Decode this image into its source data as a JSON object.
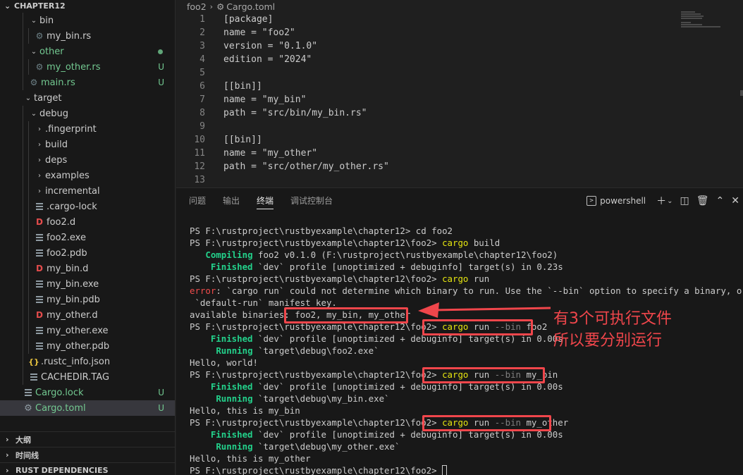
{
  "explorer": {
    "title": "CHAPTER12",
    "items": [
      {
        "label": "bin",
        "kind": "folder",
        "open": true,
        "depth": 2
      },
      {
        "label": "my_bin.rs",
        "kind": "rust",
        "depth": 3
      },
      {
        "label": "other",
        "kind": "folder",
        "open": true,
        "depth": 2,
        "git": true,
        "dot": true
      },
      {
        "label": "my_other.rs",
        "kind": "rust",
        "depth": 3,
        "git": true,
        "badge": "U"
      },
      {
        "label": "main.rs",
        "kind": "rust",
        "depth": 2,
        "git": true,
        "badge": "U"
      },
      {
        "label": "target",
        "kind": "folder",
        "open": true,
        "depth": 1
      },
      {
        "label": "debug",
        "kind": "folder",
        "open": true,
        "depth": 2
      },
      {
        "label": ".fingerprint",
        "kind": "folder",
        "open": false,
        "depth": 3
      },
      {
        "label": "build",
        "kind": "folder",
        "open": false,
        "depth": 3
      },
      {
        "label": "deps",
        "kind": "folder",
        "open": false,
        "depth": 3
      },
      {
        "label": "examples",
        "kind": "folder",
        "open": false,
        "depth": 3
      },
      {
        "label": "incremental",
        "kind": "folder",
        "open": false,
        "depth": 3
      },
      {
        "label": ".cargo-lock",
        "kind": "lines",
        "depth": 3
      },
      {
        "label": "foo2.d",
        "kind": "d",
        "depth": 3
      },
      {
        "label": "foo2.exe",
        "kind": "lines",
        "depth": 3
      },
      {
        "label": "foo2.pdb",
        "kind": "lines",
        "depth": 3
      },
      {
        "label": "my_bin.d",
        "kind": "d",
        "depth": 3
      },
      {
        "label": "my_bin.exe",
        "kind": "lines",
        "depth": 3
      },
      {
        "label": "my_bin.pdb",
        "kind": "lines",
        "depth": 3
      },
      {
        "label": "my_other.d",
        "kind": "d",
        "depth": 3
      },
      {
        "label": "my_other.exe",
        "kind": "lines",
        "depth": 3
      },
      {
        "label": "my_other.pdb",
        "kind": "lines",
        "depth": 3
      },
      {
        "label": ".rustc_info.json",
        "kind": "json",
        "depth": 2
      },
      {
        "label": "CACHEDIR.TAG",
        "kind": "lines",
        "depth": 2
      },
      {
        "label": "Cargo.lock",
        "kind": "lines",
        "depth": 1,
        "git": true,
        "badge": "U"
      },
      {
        "label": "Cargo.toml",
        "kind": "gear",
        "depth": 1,
        "git": true,
        "badge": "U",
        "selected": true
      }
    ],
    "sections": [
      "大纲",
      "时间线",
      "RUST DEPENDENCIES"
    ]
  },
  "breadcrumb": {
    "folder": "foo2",
    "file": "Cargo.toml"
  },
  "code_lines": [
    "[package]",
    "name = \"foo2\"",
    "version = \"0.1.0\"",
    "edition = \"2024\"",
    "",
    "[[bin]]",
    "name = \"my_bin\"",
    "path = \"src/bin/my_bin.rs\"",
    "",
    "[[bin]]",
    "name = \"my_other\"",
    "path = \"src/other/my_other.rs\"",
    ""
  ],
  "panel": {
    "tabs": [
      "问题",
      "输出",
      "终端",
      "调试控制台"
    ],
    "active_tab": "终端",
    "terminal_name": "powershell"
  },
  "terminal": [
    [
      {
        "t": "PS F:\\rustproject\\rustbyexample\\chapter12> "
      },
      {
        "t": "cd foo2",
        "c": "y-plain"
      }
    ],
    [
      {
        "t": "PS F:\\rustproject\\rustbyexample\\chapter12\\foo2> "
      },
      {
        "t": "cargo",
        "c": "y"
      },
      {
        "t": " build"
      }
    ],
    [
      {
        "t": "   "
      },
      {
        "t": "Compiling",
        "c": "g"
      },
      {
        "t": " foo2 v0.1.0 (F:\\rustproject\\rustbyexample\\chapter12\\foo2)"
      }
    ],
    [
      {
        "t": "    "
      },
      {
        "t": "Finished",
        "c": "g"
      },
      {
        "t": " `dev` profile [unoptimized + debuginfo] target(s) in 0.23s"
      }
    ],
    [
      {
        "t": "PS F:\\rustproject\\rustbyexample\\chapter12\\foo2> "
      },
      {
        "t": "cargo",
        "c": "y"
      },
      {
        "t": " run"
      }
    ],
    [
      {
        "t": "error",
        "c": "r"
      },
      {
        "t": ": `cargo run` could not determine which binary to run. Use the `--bin` option to specify a binary, or the"
      }
    ],
    [
      {
        "t": " `default-run` manifest key."
      }
    ],
    [
      {
        "t": "available binaries: foo2, my_bin, my_other"
      }
    ],
    [
      {
        "t": "PS F:\\rustproject\\rustbyexample\\chapter12\\foo2> "
      },
      {
        "t": "cargo",
        "c": "y"
      },
      {
        "t": " run "
      },
      {
        "t": "--bin",
        "c": "flag"
      },
      {
        "t": " foo2"
      }
    ],
    [
      {
        "t": "    "
      },
      {
        "t": "Finished",
        "c": "g"
      },
      {
        "t": " `dev` profile [unoptimized + debuginfo] target(s) in 0.00s"
      }
    ],
    [
      {
        "t": "     "
      },
      {
        "t": "Running",
        "c": "g"
      },
      {
        "t": " `target\\debug\\foo2.exe`"
      }
    ],
    [
      {
        "t": "Hello, world!"
      }
    ],
    [
      {
        "t": "PS F:\\rustproject\\rustbyexample\\chapter12\\foo2> "
      },
      {
        "t": "cargo",
        "c": "y"
      },
      {
        "t": " run "
      },
      {
        "t": "--bin",
        "c": "flag"
      },
      {
        "t": " my_bin"
      }
    ],
    [
      {
        "t": "    "
      },
      {
        "t": "Finished",
        "c": "g"
      },
      {
        "t": " `dev` profile [unoptimized + debuginfo] target(s) in 0.00s"
      }
    ],
    [
      {
        "t": "     "
      },
      {
        "t": "Running",
        "c": "g"
      },
      {
        "t": " `target\\debug\\my_bin.exe`"
      }
    ],
    [
      {
        "t": "Hello, this is my_bin"
      }
    ],
    [
      {
        "t": "PS F:\\rustproject\\rustbyexample\\chapter12\\foo2> "
      },
      {
        "t": "cargo",
        "c": "y"
      },
      {
        "t": " run "
      },
      {
        "t": "--bin",
        "c": "flag"
      },
      {
        "t": " my_other"
      }
    ],
    [
      {
        "t": "    "
      },
      {
        "t": "Finished",
        "c": "g"
      },
      {
        "t": " `dev` profile [unoptimized + debuginfo] target(s) in 0.00s"
      }
    ],
    [
      {
        "t": "     "
      },
      {
        "t": "Running",
        "c": "g"
      },
      {
        "t": " `target\\debug\\my_other.exe`"
      }
    ],
    [
      {
        "t": "Hello, this is my_other"
      }
    ],
    [
      {
        "t": "PS F:\\rustproject\\rustbyexample\\chapter12\\foo2> "
      },
      {
        "t": "",
        "c": "cursor"
      }
    ]
  ],
  "annotation": {
    "note": "有3个可执行文件\n所以要分别运行",
    "color": "#f0464b"
  },
  "colors": {
    "editor_bg": "#1f1f1f",
    "sidebar_bg": "#181818",
    "git_untracked": "#73c991",
    "terminal_yellow": "#e5e510",
    "terminal_green": "#23d18b",
    "terminal_error": "#f14c4c"
  }
}
